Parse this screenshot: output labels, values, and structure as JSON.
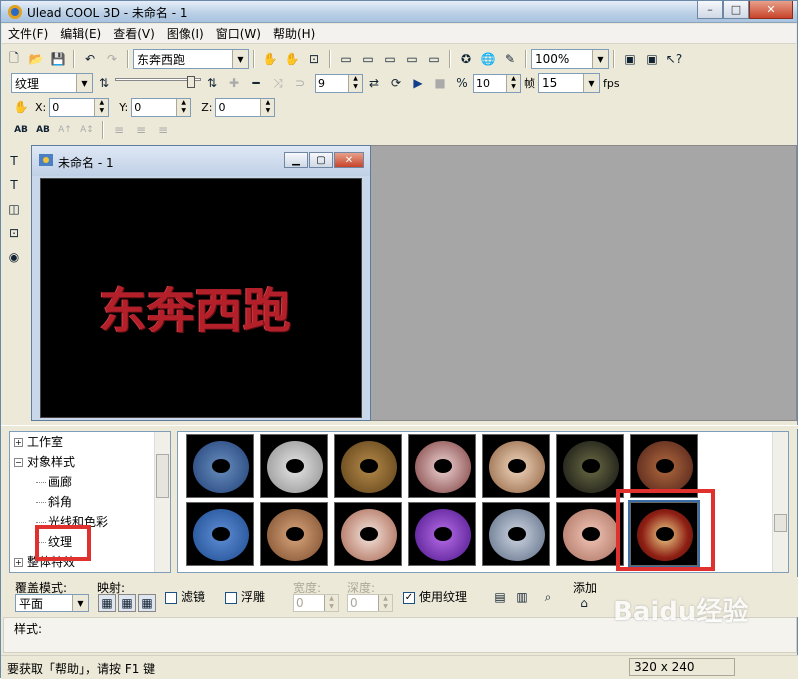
{
  "app": {
    "title": "Ulead COOL 3D - 未命名 - 1"
  },
  "window": {
    "min": "–",
    "max": "□",
    "close": "✕"
  },
  "menu": [
    "文件(F)",
    "编辑(E)",
    "查看(V)",
    "图像(I)",
    "窗口(W)",
    "帮助(H)"
  ],
  "toolbar1": {
    "text_combo": "东奔西跑",
    "zoom_combo": "100%"
  },
  "toolbar2": {
    "mode_combo": "纹理",
    "frame_value": "9",
    "frames_value": "10",
    "frame_label": "帧",
    "fps_value": "15",
    "fps_label": "fps"
  },
  "toolbar3": {
    "x_label": "X:",
    "x_value": "0",
    "y_label": "Y:",
    "y_value": "0",
    "z_label": "Z:",
    "z_value": "0"
  },
  "toolbar4": {
    "b1": "AB",
    "b2": "AB",
    "b3": "A↑",
    "b4": "A↕"
  },
  "document": {
    "title": "未命名 - 1",
    "canvas_text": "东奔西跑"
  },
  "tree": {
    "items": [
      {
        "label": "工作室",
        "type": "node",
        "expander": "+"
      },
      {
        "label": "对象样式",
        "type": "node",
        "expander": "−"
      },
      {
        "label": "画廊",
        "type": "leaf"
      },
      {
        "label": "斜角",
        "type": "leaf"
      },
      {
        "label": "光线和色彩",
        "type": "leaf"
      },
      {
        "label": "纹理",
        "type": "leaf"
      },
      {
        "label": "整体特效",
        "type": "node",
        "expander": "+"
      }
    ]
  },
  "options": {
    "overlay_label": "覆盖模式:",
    "overlay_value": "平面",
    "mapping_label": "映射:",
    "filter_label": "滤镜",
    "emboss_label": "浮雕",
    "width_label": "宽度:",
    "width_value": "0",
    "depth_label": "深度:",
    "depth_value": "0",
    "use_texture_label": "使用纹理",
    "use_texture_check": "✓",
    "add_label": "添加"
  },
  "style_bar": {
    "label": "样式:"
  },
  "status": {
    "help": "要获取「帮助」，请按 F1 键",
    "size": "320 x 240"
  },
  "watermark": "Baidu经验",
  "colors": {
    "accent_highlight": "#e1312f",
    "canvas_text": "#b3202a"
  }
}
